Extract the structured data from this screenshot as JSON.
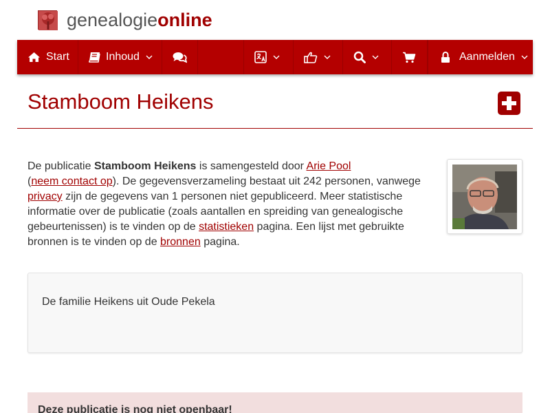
{
  "brand": {
    "name_part1": "genealogie",
    "name_part2": "online",
    "logo_icon": "tree-icon"
  },
  "colors": {
    "accent": "#b40000",
    "title": "#a00000",
    "alert_bg": "#f2dede"
  },
  "nav": {
    "start": {
      "label": "Start",
      "icon": "home-icon"
    },
    "inhoud": {
      "label": "Inhoud",
      "icon": "book-icon"
    },
    "chat": {
      "icon": "comments-icon"
    },
    "language": {
      "icon": "translate-icon"
    },
    "share": {
      "icon": "thumbs-up-icon"
    },
    "search": {
      "icon": "search-icon"
    },
    "cart": {
      "icon": "cart-icon"
    },
    "login": {
      "label": "Aanmelden",
      "icon": "lock-icon"
    }
  },
  "page": {
    "title": "Stamboom Heikens",
    "add_icon": "plus-square-icon"
  },
  "intro": {
    "t1": "De publicatie ",
    "pub_name": "Stamboom Heikens",
    "t2": " is samengesteld door ",
    "author": "Arie Pool",
    "t3": " (",
    "contact": "neem contact op",
    "t4": "). De gegevensverzameling bestaat uit 242 personen, vanwege ",
    "privacy": "privacy",
    "t5": " zijn de gegevens van 1 personen niet gepubliceerd. Meer statistische informatie over de publicatie (zoals aantallen en spreiding van genealogische gebeurtenissen) is te vinden op de ",
    "stats": "statistieken",
    "t6": " pagina. Een lijst met gebruikte bronnen is te vinden op de ",
    "sources": "bronnen",
    "t7": " pagina."
  },
  "description": "De familie Heikens uit Oude Pekela",
  "alert": "Deze publicatie is nog niet openbaar!"
}
